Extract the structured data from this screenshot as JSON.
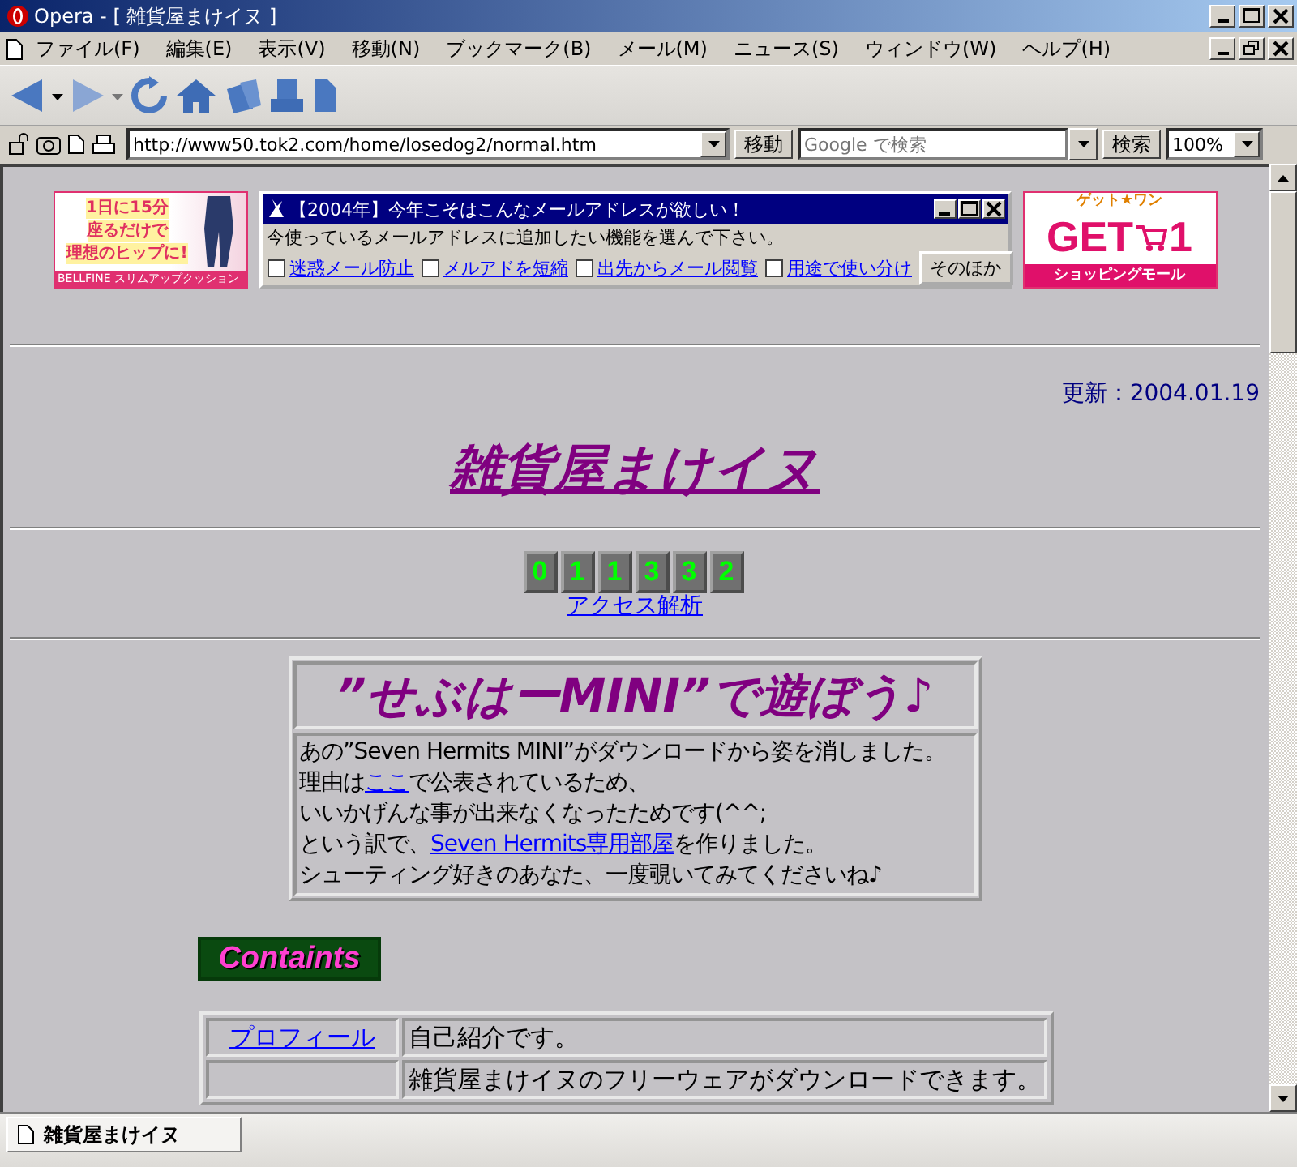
{
  "window": {
    "title": "Opera - [ 雑貨屋まけイヌ ]"
  },
  "menu": [
    "ファイル(F)",
    "編集(E)",
    "表示(V)",
    "移動(N)",
    "ブックマーク(B)",
    "メール(M)",
    "ニュース(S)",
    "ウィンドウ(W)",
    "ヘルプ(H)"
  ],
  "address_bar": {
    "url": "http://www50.tok2.com/home/losedog2/normal.htm",
    "go_button": "移動",
    "search_placeholder": "Google で検索",
    "search_button": "検索",
    "zoom": "100%"
  },
  "ads": {
    "left": {
      "lines": [
        "1日に15分",
        "座るだけで",
        "理想のヒップに!"
      ],
      "caption": "BELLFINE スリムアップクッション"
    },
    "popup": {
      "title": "【2004年】今年こそはこんなメールアドレスが欲しい！",
      "prompt": "今使っているメールアドレスに追加したい機能を選んで下さい。",
      "options": [
        {
          "label": "迷惑メール防止",
          "checked": false
        },
        {
          "label": "メルアドを短縮",
          "checked": false
        },
        {
          "label": "出先からメール閲覧",
          "checked": false
        },
        {
          "label": "用途で使い分け",
          "checked": false
        }
      ],
      "button": "そのほか"
    },
    "right": {
      "tagline": "ゲット★ワン",
      "logo": "GET",
      "digit": "1",
      "caption": "ショッピングモール"
    }
  },
  "updated": "更新：2004.01.19",
  "site_title": "雑貨屋まけイヌ",
  "counter": {
    "digits": [
      "0",
      "1",
      "1",
      "3",
      "3",
      "2"
    ],
    "link": "アクセス解析"
  },
  "notice": {
    "heading": "”せぶはーMINI”で遊ぼう♪",
    "lines": [
      [
        {
          "kind": "text",
          "text": "あの”Seven Hermits MINI”がダウンロードから姿を消しました。"
        }
      ],
      [
        {
          "kind": "text",
          "text": "理由は"
        },
        {
          "kind": "link",
          "text": "ここ"
        },
        {
          "kind": "text",
          "text": "で公表されているため、"
        }
      ],
      [
        {
          "kind": "text",
          "text": "いいかげんな事が出来なくなったためです(^^;"
        }
      ],
      [
        {
          "kind": "text",
          "text": "という訳で、"
        },
        {
          "kind": "link",
          "text": "Seven Hermits専用部屋"
        },
        {
          "kind": "text",
          "text": "を作りました。"
        }
      ],
      [
        {
          "kind": "text",
          "text": "シューティング好きのあなた、一度覗いてみてくださいね♪"
        }
      ]
    ]
  },
  "contents_banner": "Containts",
  "table": {
    "rows": [
      {
        "link": "プロフィール",
        "description": "自己紹介です。"
      },
      {
        "description": "雑貨屋まけイヌのフリーウェアがダウンロードできます。"
      }
    ]
  },
  "status_bar": {
    "tab": "雑貨屋まけイヌ"
  }
}
